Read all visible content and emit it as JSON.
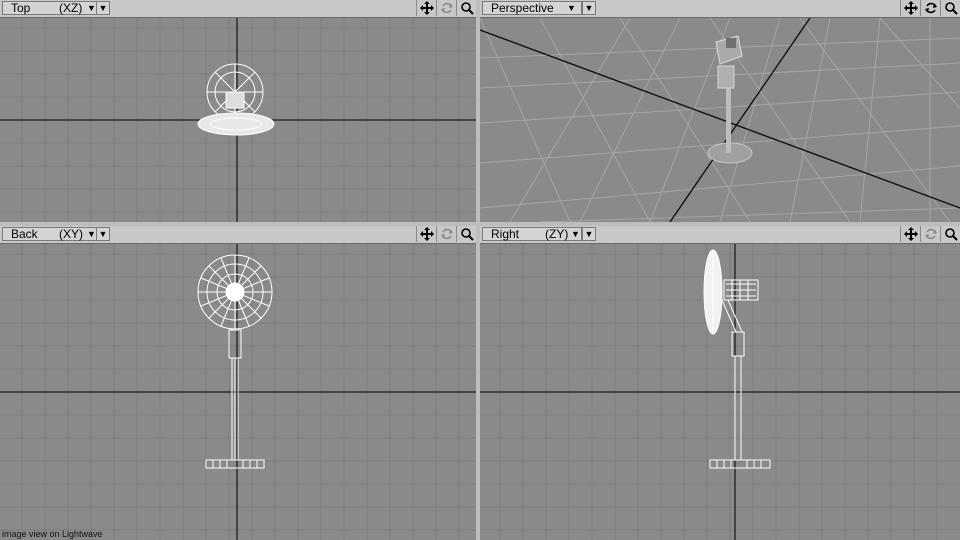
{
  "viewports": {
    "top": {
      "name": "Top",
      "axis": "(XZ)"
    },
    "perspective": {
      "name": "Perspective"
    },
    "back": {
      "name": "Back",
      "axis": "(XY)"
    },
    "right": {
      "name": "Right",
      "axis": "(ZY)"
    }
  },
  "icons": {
    "move": "move-icon",
    "rotate": "rotate-icon",
    "zoom": "zoom-icon",
    "dropdown": "caret-down-icon"
  },
  "caption": "image view on Lightwave",
  "colors": {
    "grid": "#7d7d7d",
    "axis": "#000000",
    "wireframe": "#ffffff",
    "header": "#c8c8c8"
  }
}
